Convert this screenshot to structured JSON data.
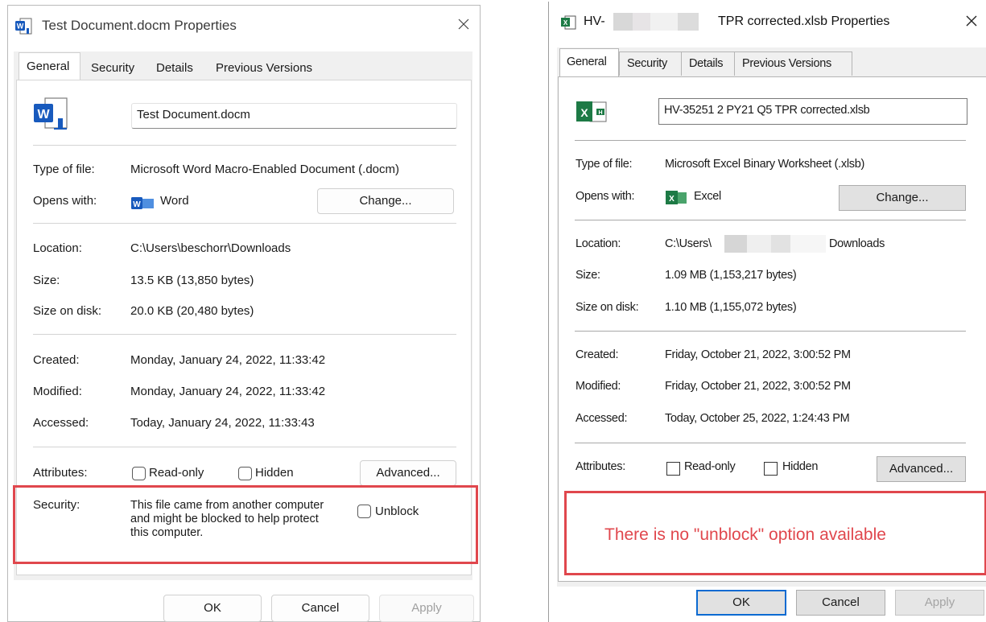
{
  "left_dialog": {
    "title": "Test Document.docm Properties",
    "tabs": [
      "General",
      "Security",
      "Details",
      "Previous Versions"
    ],
    "file_name": "Test Document.docm",
    "type_label": "Type of file:",
    "type_value": "Microsoft Word Macro-Enabled Document (.docm)",
    "opens_label": "Opens with:",
    "opens_value": "Word",
    "change_button": "Change...",
    "location_label": "Location:",
    "location_value": "C:\\Users\\beschorr\\Downloads",
    "size_label": "Size:",
    "size_value": "13.5 KB (13,850 bytes)",
    "disk_label": "Size on disk:",
    "disk_value": "20.0 KB (20,480 bytes)",
    "created_label": "Created:",
    "created_value": "Monday, January 24, 2022, 11:33:42",
    "modified_label": "Modified:",
    "modified_value": "Monday, January 24, 2022, 11:33:42",
    "accessed_label": "Accessed:",
    "accessed_value": "Today, January 24, 2022, 11:33:43",
    "attributes_label": "Attributes:",
    "readonly_label": "Read-only",
    "hidden_label": "Hidden",
    "advanced_button": "Advanced...",
    "security_label": "Security:",
    "security_line1": "This file came from another computer",
    "security_line2": "and might be blocked to help protect",
    "security_line3": "this computer.",
    "unblock_label": "Unblock",
    "ok_button": "OK",
    "cancel_button": "Cancel",
    "apply_button": "Apply"
  },
  "right_dialog": {
    "title_prefix": "HV-",
    "title_suffix": "TPR corrected.xlsb Properties",
    "tabs": [
      "General",
      "Security",
      "Details",
      "Previous Versions"
    ],
    "file_name": "HV-35251 2 PY21 Q5 TPR corrected.xlsb",
    "type_label": "Type of file:",
    "type_value": "Microsoft Excel Binary Worksheet (.xlsb)",
    "opens_label": "Opens with:",
    "opens_value": "Excel",
    "change_button": "Change...",
    "location_label": "Location:",
    "location_prefix": "C:\\Users\\",
    "location_suffix": "Downloads",
    "size_label": "Size:",
    "size_value": "1.09 MB (1,153,217 bytes)",
    "disk_label": "Size on disk:",
    "disk_value": "1.10 MB (1,155,072 bytes)",
    "created_label": "Created:",
    "created_value": "Friday, October 21, 2022, 3:00:52 PM",
    "modified_label": "Modified:",
    "modified_value": "Friday, October 21, 2022, 3:00:52 PM",
    "accessed_label": "Accessed:",
    "accessed_value": "Today, October 25, 2022, 1:24:43 PM",
    "attributes_label": "Attributes:",
    "readonly_label": "Read-only",
    "hidden_label": "Hidden",
    "advanced_button": "Advanced...",
    "annotation": "There is no \"unblock\" option available",
    "ok_button": "OK",
    "cancel_button": "Cancel",
    "apply_button": "Apply"
  },
  "colors": {
    "annotation_red": "#e0474d",
    "word_blue": "#185abd",
    "excel_green": "#1d7a45"
  }
}
